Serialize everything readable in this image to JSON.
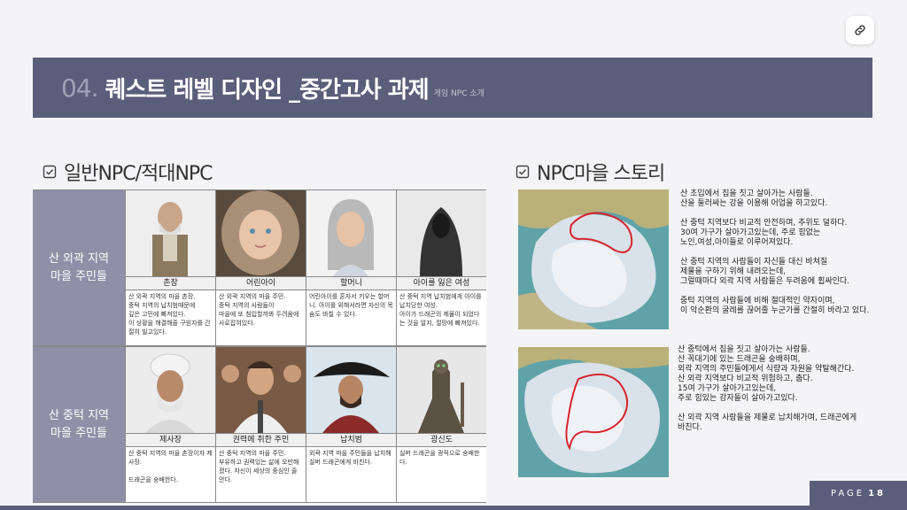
{
  "header": {
    "num": "04.",
    "title": "퀘스트 레벨 디자인 _중간고사 과제",
    "subtitle": "게임 NPC 소개"
  },
  "left_section": {
    "title": "일반NPC/적대NPC"
  },
  "right_section": {
    "title": "NPC마을 스토리"
  },
  "groups": [
    {
      "label": "산 외곽 지역\n마을 주민들",
      "npcs": [
        {
          "name": "촌장",
          "desc": "산 외곽 지역의 마을 촌장.\n중턱 지역의 납치범때문에\n깊은 고민에 빠져있다.\n이 상황을 해결해줄 구원자를 간절히 빌고있다."
        },
        {
          "name": "어린아이",
          "desc": "산 외곽 지역의 마을 주민.\n중턱 지역의 사람들이\n마을에 또 침입할까봐 두려움에 사로잡혀있다."
        },
        {
          "name": "할머니",
          "desc": "어린아이를 혼자서 키우는 할머니. 아이를 위해서라면 자신의 목숨도 바칠 수 있다."
        },
        {
          "name": "아이를 잃은 여성",
          "desc": "산 중턱 지역 납치범에게 아이를 납치당한 여성.\n아이가 드래곤의 제물이 되었다는 것을 알지, 절망에 빠져있다."
        }
      ]
    },
    {
      "label": "산 중턱 지역\n마을 주민들",
      "npcs": [
        {
          "name": "제사장",
          "desc": "산 중턱 지역의 마을 촌장이자 제사장.\n\n드래곤을 숭배한다."
        },
        {
          "name": "권력에 취한 주민",
          "desc": "산 중턱 지역의 마을 주민.\n부유하고 권력있는 삶에 오만해졌다. 자신이 세상의 중심인 줄 안다."
        },
        {
          "name": "납치범",
          "desc": "외곽 지역 마을 주민들을 납치해 실버 드래곤에게 바친다."
        },
        {
          "name": "광신도",
          "desc": "실버 드래곤을 광적으로 숭배한다."
        }
      ]
    }
  ],
  "stories": [
    {
      "text": "산 초입에서 집을 짓고 살아가는 사람들.\n산을 둘러싸는 강을 이용해 어업을 하고있다.\n\n산 중턱 지역보다 비교적 안전하며, 추위도 덜하다.\n30여 가구가 살아가고있는데, 주로 힘없는\n노인,여성,아이들로 이루어져있다.\n\n산 중턱 지역의 사람들이 자신들 대신 바쳐질\n제물을 구하기 위해 내려오는데,\n그럴때마다 외곽 지역 사람들은 두려움에 휩싸인다.\n\n중턱 지역의 사람들에 비해 절대적인 약자이며,\n이 악순환의 굴레를 끊어줄 누군가를 간절히 바라고 있다."
    },
    {
      "text": "산 중턱에서 집을 짓고 살아가는 사람들.\n산 꼭대기에 있는 드래곤을 숭배하며,\n외곽 지역의 주민들에게서 식량과 자원을 약탈해간다.\n산 외곽 지역보다 비교적 위험하고, 춥다.\n15여 가구가 살아가고있는데,\n주로 힘있는 강자들이 살아가고있다.\n\n산 외곽 지역 사람들을 제물로 납치해가며, 드래곤에게\n바친다."
    }
  ],
  "footer": {
    "page_label": "PAGE",
    "page_num": "18"
  },
  "colors": {
    "accent": "#5b5e7a",
    "row_label": "#8f90a8",
    "route": "#d8242e"
  }
}
